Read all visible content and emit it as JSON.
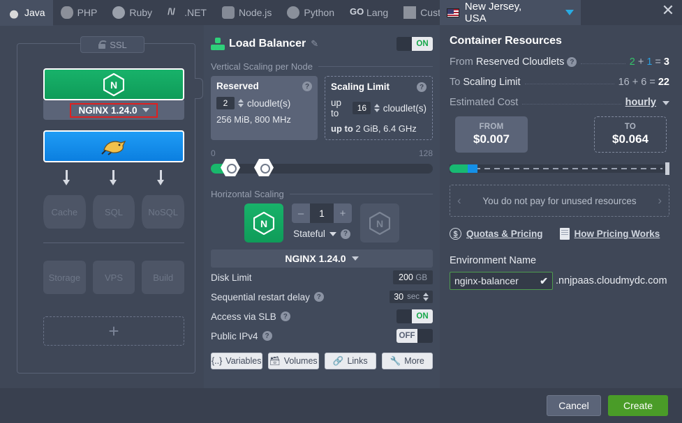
{
  "tabs": [
    {
      "label": "Java",
      "icon": "java-icon",
      "active": true
    },
    {
      "label": "PHP",
      "icon": "php-elephant-icon",
      "active": false
    },
    {
      "label": "Ruby",
      "icon": "ruby-gem-icon",
      "active": false
    },
    {
      "label": ".NET",
      "icon": "dotnet-icon",
      "active": false
    },
    {
      "label": "Node.js",
      "icon": "nodejs-icon",
      "active": false
    },
    {
      "label": "Python",
      "icon": "python-icon",
      "active": false
    },
    {
      "label": "Lang",
      "icon": "go-lang-icon",
      "active": false
    },
    {
      "label": "Custom",
      "icon": "custom-stack-icon",
      "active": false
    }
  ],
  "region_tab": {
    "label": "New Jersey, USA",
    "icon": "us-flag-icon",
    "caret": "chevron-down-icon"
  },
  "close_label": "✕",
  "topology": {
    "ssl_label": "SSL",
    "nginx_node": {
      "icon": "nginx-logo-icon",
      "version_label": "NGINX 1.24.0",
      "caret": "chevron-down-icon"
    },
    "tomcat_node": {
      "icon": "tomcat-cat-icon"
    },
    "db_slots": [
      "Cache",
      "SQL",
      "NoSQL"
    ],
    "extra_slots": [
      "Storage",
      "VPS",
      "Build"
    ],
    "add_label": "+"
  },
  "center": {
    "title": "Load Balancer",
    "title_icon": "load-balancer-tree-icon",
    "edit_icon": "pencil-icon",
    "toggle_label": "ON",
    "vertical_section": "Vertical Scaling per Node",
    "reserved": {
      "title": "Reserved",
      "value": "2",
      "unit": "cloudlet(s)",
      "spec": "256 MiB, 800 MHz",
      "help": "?"
    },
    "scaling_limit": {
      "title": "Scaling Limit",
      "prefix": "up to",
      "value": "16",
      "unit": "cloudlet(s)",
      "spec_prefix": "up to",
      "spec": "2 GiB, 6.4 GHz",
      "help": "?"
    },
    "slider": {
      "min": "0",
      "max": "128"
    },
    "horizontal_section": "Horizontal Scaling",
    "node_count": "1",
    "minus": "–",
    "plus": "+",
    "stateful_label": "Stateful",
    "stateful_help": "?",
    "version_bar": "NGINX 1.24.0",
    "settings": [
      {
        "label": "Disk Limit",
        "value": "200",
        "unit": "GB",
        "help": false
      },
      {
        "label": "Sequential restart delay",
        "value": "30",
        "unit": "sec",
        "help": true
      }
    ],
    "access_slb": {
      "label": "Access via SLB",
      "state": "ON",
      "help": "?"
    },
    "public_ipv4": {
      "label": "Public IPv4",
      "state": "OFF",
      "help": "?"
    },
    "buttons": [
      {
        "label": "Variables",
        "icon": "variables-braces-icon"
      },
      {
        "label": "Volumes",
        "icon": "volumes-folder-icon"
      },
      {
        "label": "Links",
        "icon": "links-chain-icon"
      },
      {
        "label": "More",
        "icon": "wrench-icon"
      }
    ]
  },
  "right": {
    "title": "Container Resources",
    "rows": [
      {
        "prefix": "From",
        "name": "Reserved Cloudlets",
        "help": "?",
        "a": "2",
        "plus": "+",
        "b": "1",
        "eq": "=",
        "total": "3",
        "accent": true
      },
      {
        "prefix": "To",
        "name": "Scaling Limit",
        "help": "",
        "a": "16",
        "plus": "+",
        "b": "6",
        "eq": "=",
        "total": "22",
        "accent": false
      }
    ],
    "estimated_cost_label": "Estimated Cost",
    "period": "hourly",
    "price_from": {
      "label": "FROM",
      "value": "$0.007"
    },
    "price_to": {
      "label": "TO",
      "value": "$0.064"
    },
    "unused_note": "You do not pay for unused resources",
    "links": [
      {
        "label": "Quotas & Pricing",
        "icon": "dollar-circle-icon"
      },
      {
        "label": "How Pricing Works",
        "icon": "document-icon"
      }
    ],
    "env_name_label": "Environment Name",
    "env_name_value": "nginx-balancer",
    "env_check": "✔",
    "env_suffix": ".nnjpaas.cloudmydc.com"
  },
  "footer": {
    "cancel": "Cancel",
    "create": "Create"
  },
  "colors": {
    "accent_green": "#18b26a",
    "accent_blue": "#1490e8",
    "create_green": "#4a9c28",
    "highlight_red": "#e02020",
    "panel_bg": "#3f4757",
    "center_bg": "#414a5b"
  }
}
